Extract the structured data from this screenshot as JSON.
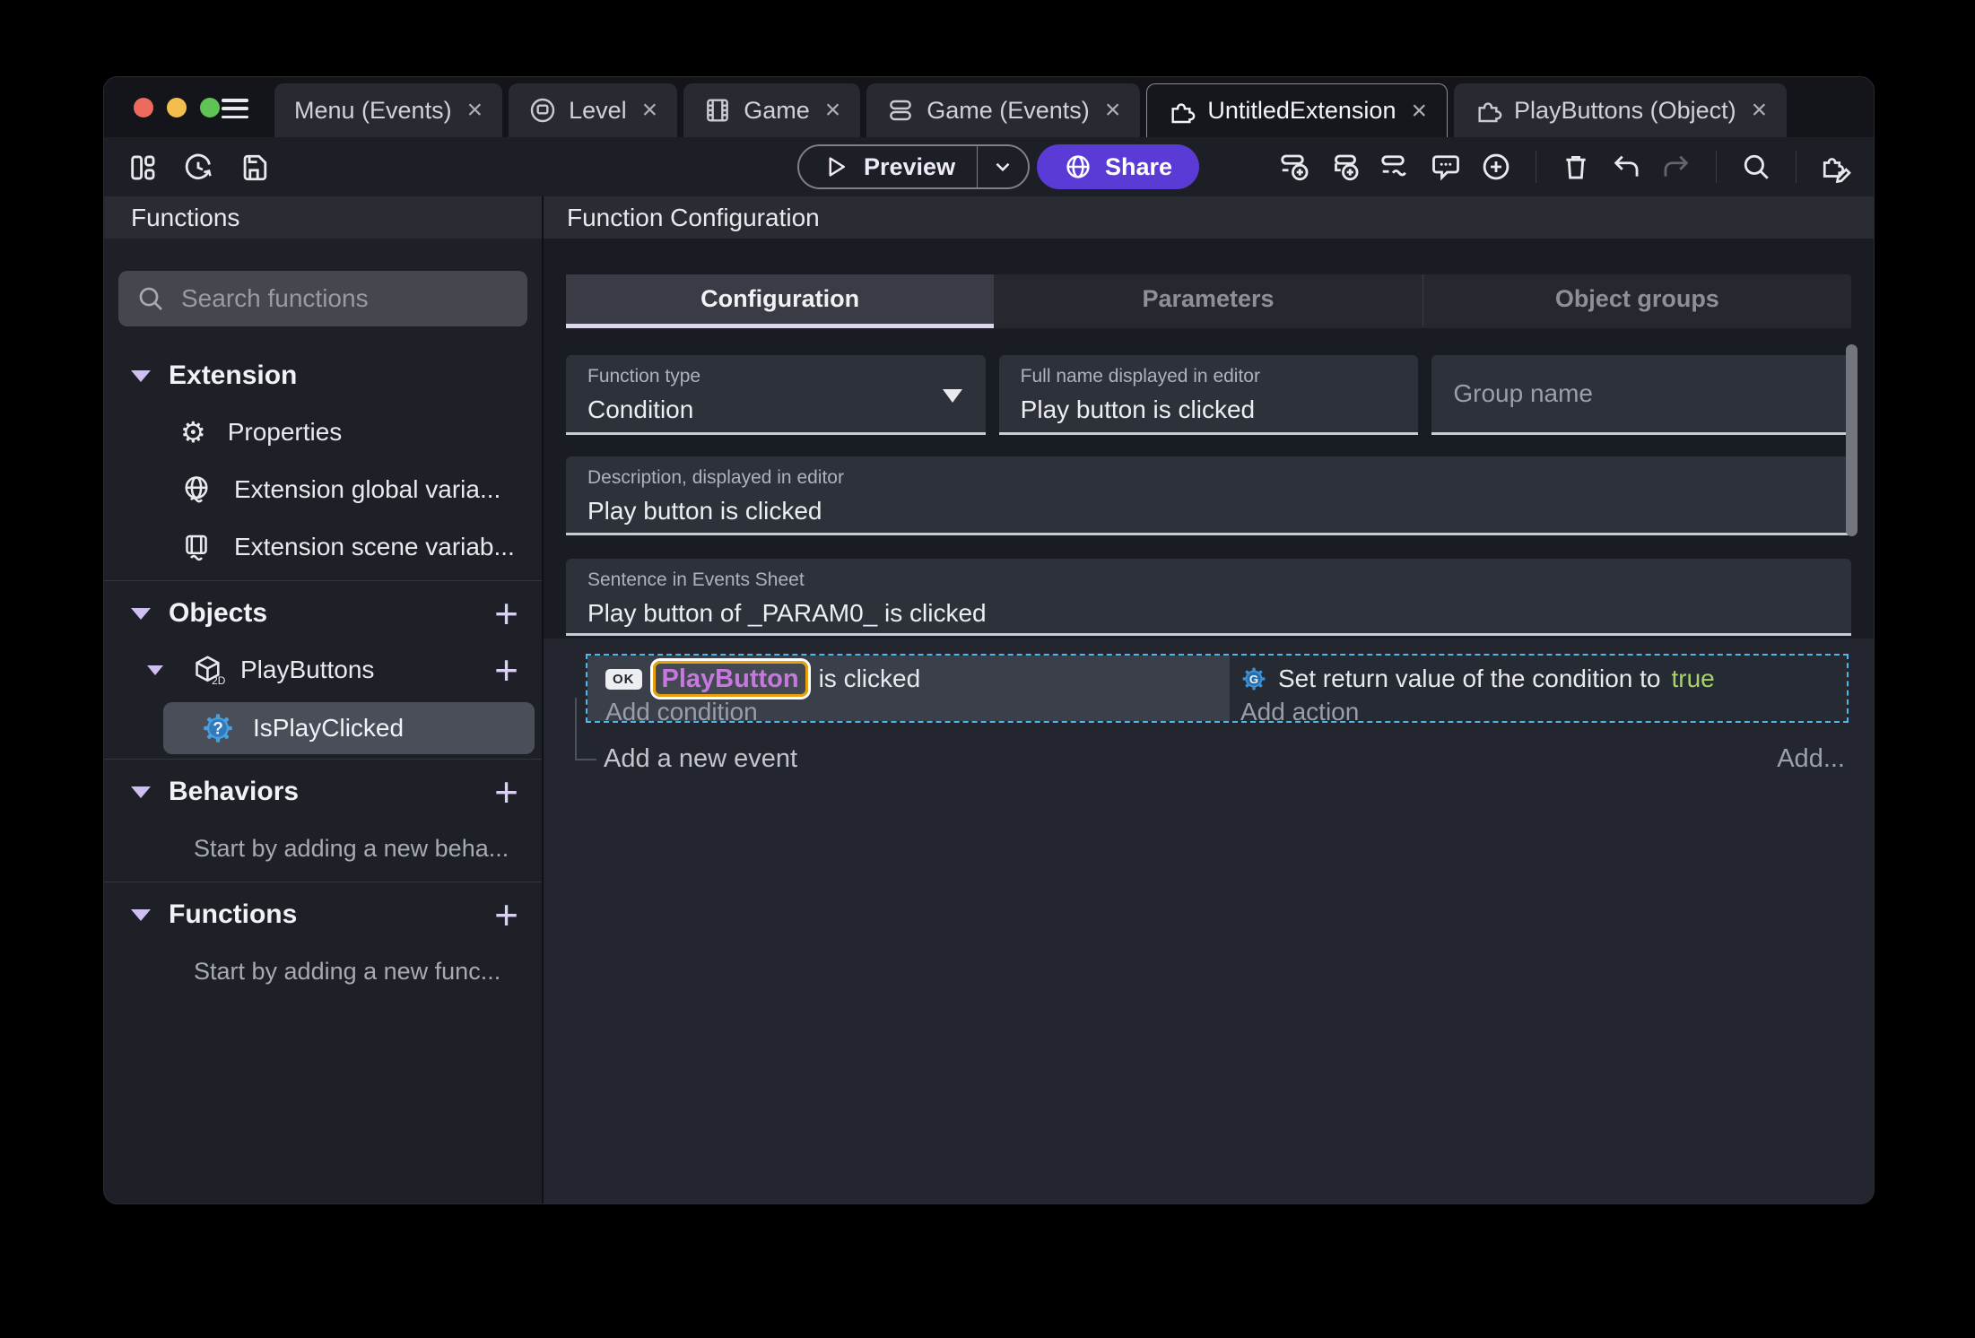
{
  "window": {
    "traffic_lights": {
      "close": "#EC6A5E",
      "minimize": "#F4BE4F",
      "zoom": "#5FC454"
    },
    "close_glyph": "×",
    "tabs": [
      {
        "label": "Menu (Events)",
        "icon": "none",
        "close": "×",
        "active": false
      },
      {
        "label": "Level",
        "icon": "scene-icon",
        "close": "×",
        "active": false
      },
      {
        "label": "Game",
        "icon": "film-icon",
        "close": "×",
        "active": false
      },
      {
        "label": "Game (Events)",
        "icon": "events-icon",
        "close": "×",
        "active": false
      },
      {
        "label": "UntitledExtension",
        "icon": "puzzle-icon",
        "close": "×",
        "active": true
      },
      {
        "label": "PlayButtons (Object)",
        "icon": "puzzle-icon",
        "close": "×",
        "active": false
      }
    ]
  },
  "toolbar": {
    "preview_label": "Preview",
    "share_label": "Share",
    "left_icons": [
      "panels-icon",
      "history-icon",
      "save-icon"
    ],
    "right_icons": [
      "add-event-icon",
      "add-subevent-icon",
      "add-other-events-icon",
      "comment-icon",
      "circle-plus-icon",
      "trash-icon",
      "undo-icon",
      "redo-icon",
      "search-icon",
      "edit-extension-icon"
    ],
    "colors": {
      "share_bg": "#5B3BD5",
      "preview_border": "#7E8089"
    }
  },
  "sidebar": {
    "header": "Functions",
    "search_placeholder": "Search functions",
    "tree": [
      {
        "type": "section",
        "label": "Extension"
      },
      {
        "type": "item",
        "label": "Properties",
        "icon": "gear-icon"
      },
      {
        "type": "item",
        "label": "Extension global varia...",
        "icon": "globe-variable-icon"
      },
      {
        "type": "item",
        "label": "Extension scene variab...",
        "icon": "scene-variable-icon"
      },
      {
        "type": "section",
        "label": "Objects",
        "add": "+"
      },
      {
        "type": "subitem",
        "label": "PlayButtons",
        "icon": "object-2d-icon",
        "add": "+"
      },
      {
        "type": "selected",
        "label": "IsPlayClicked",
        "icon": "condition-function-icon"
      },
      {
        "type": "section",
        "label": "Behaviors",
        "add": "+"
      },
      {
        "type": "hint",
        "label": "Start by adding a new beha..."
      },
      {
        "type": "section",
        "label": "Functions",
        "add": "+"
      },
      {
        "type": "hint",
        "label": "Start by adding a new func..."
      }
    ]
  },
  "main": {
    "header": "Function Configuration",
    "tabs": [
      {
        "label": "Configuration",
        "active": true
      },
      {
        "label": "Parameters",
        "active": false
      },
      {
        "label": "Object groups",
        "active": false
      }
    ],
    "fields": {
      "function_type": {
        "label": "Function type",
        "value": "Condition"
      },
      "full_name": {
        "label": "Full name displayed in editor",
        "value": "Play button is clicked"
      },
      "group_name": {
        "placeholder": "Group name"
      },
      "description": {
        "label": "Description, displayed in editor",
        "value": "Play button is clicked"
      },
      "sentence": {
        "label": "Sentence in Events Sheet",
        "value": "Play button of _PARAM0_ is clicked"
      }
    },
    "events": {
      "object_chip": "OK",
      "condition_object": "PlayButton",
      "condition_text": "is clicked",
      "add_condition": "Add condition",
      "action_text": "Set return value of the condition to",
      "action_value": "true",
      "add_action": "Add action",
      "add_new_event": "Add a new event",
      "add_more": "Add...",
      "colors": {
        "object_text": "#C778DE",
        "object_border": "#E8A211",
        "true_value": "#A5D36A",
        "selection_dash": "#4FB8E8"
      }
    }
  }
}
